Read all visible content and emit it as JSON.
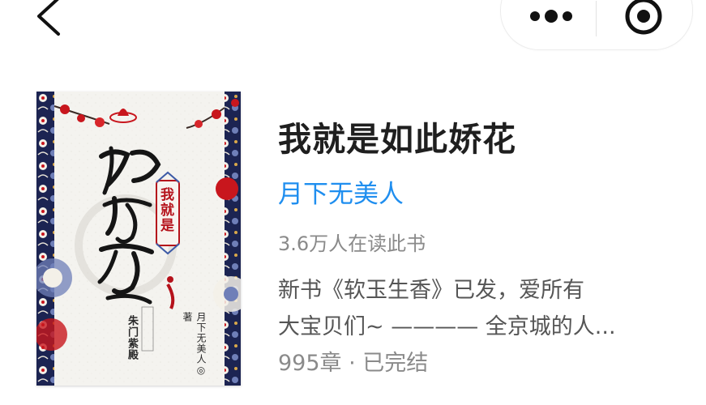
{
  "nav": {
    "back_icon": "chevron-left-icon",
    "more_icon": "more-dots-icon",
    "close_icon": "target-circle-icon"
  },
  "book": {
    "title": "我就是如此娇花",
    "author": "月下无美人",
    "readers": "3.6万人在读此书",
    "intro_line1": "新书《软玉生香》已发，爱所有",
    "intro_line2": "大宝贝们~ ———— 全京城的人...",
    "status": "995章 · 已完结"
  },
  "cover": {
    "seal_text": "我就是",
    "author_text": "月下无美人◎著",
    "publisher_text": "朱门紫殿",
    "title_calligraphy": "如此娇花"
  },
  "colors": {
    "title": "#1f1f1f",
    "author_link": "#1f8eef",
    "muted": "#8a8a8a",
    "intro": "#555555",
    "cover_navy": "#1c2452",
    "cover_red": "#c8161d"
  }
}
